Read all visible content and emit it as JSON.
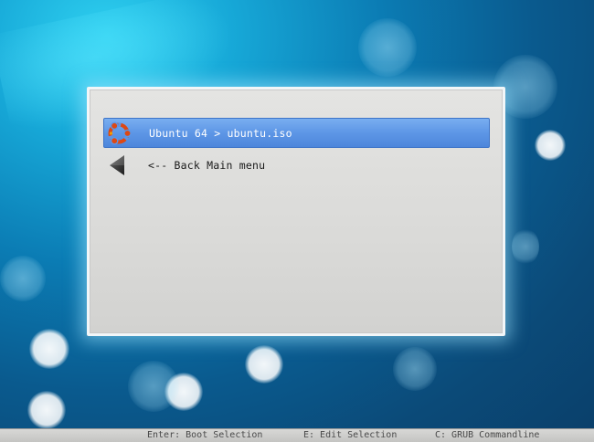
{
  "menu": {
    "entries": [
      {
        "label": "Ubuntu 64 > ubuntu.iso",
        "icon": "ubuntu-logo-icon",
        "selected": true
      },
      {
        "label": "<-- Back Main menu",
        "icon": "back-arrow-icon",
        "selected": false
      }
    ]
  },
  "status_bar": {
    "hints": [
      "Enter: Boot Selection",
      "E: Edit Selection",
      "C: GRUB Commandline"
    ]
  },
  "colors": {
    "selection": "#5d96e6",
    "panel": "#dadad8",
    "ubuntu_orange": "#dd4814"
  }
}
